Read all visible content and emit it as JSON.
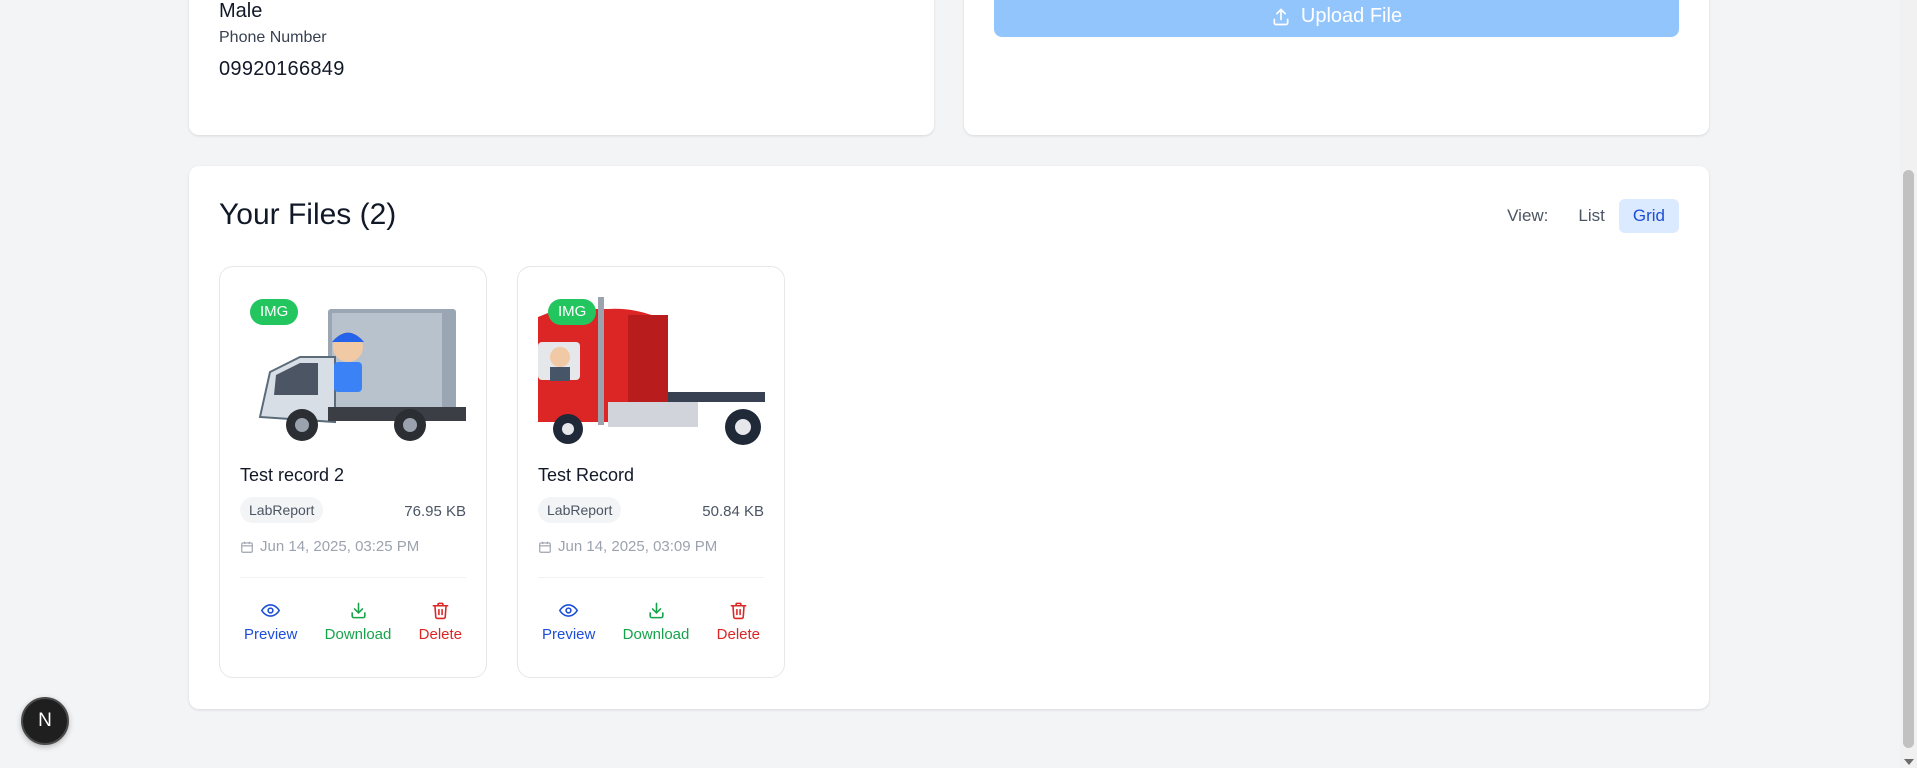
{
  "profile": {
    "gender_value": "Male",
    "phone_label": "Phone Number",
    "phone_value": "09920166849"
  },
  "upload": {
    "button_label": "Upload File",
    "icon": "upload-icon"
  },
  "files": {
    "title": "Your Files (2)",
    "view_label": "View:",
    "view_options": [
      "List",
      "Grid"
    ],
    "view_selected": "Grid",
    "items": [
      {
        "type_badge": "IMG",
        "name": "Test record 2",
        "category": "LabReport",
        "size": "76.95 KB",
        "date": "Jun 14, 2025, 03:25 PM"
      },
      {
        "type_badge": "IMG",
        "name": "Test Record",
        "category": "LabReport",
        "size": "50.84 KB",
        "date": "Jun 14, 2025, 03:09 PM"
      }
    ],
    "actions": {
      "preview": "Preview",
      "download": "Download",
      "delete": "Delete"
    }
  },
  "dev_badge": "N",
  "colors": {
    "accent": "#1d4ed8",
    "upload_button": "#93c5fd",
    "badge_green": "#22c55e",
    "download_green": "#16a34a",
    "delete_red": "#dc2626",
    "view_active_bg": "#dbeafe"
  }
}
